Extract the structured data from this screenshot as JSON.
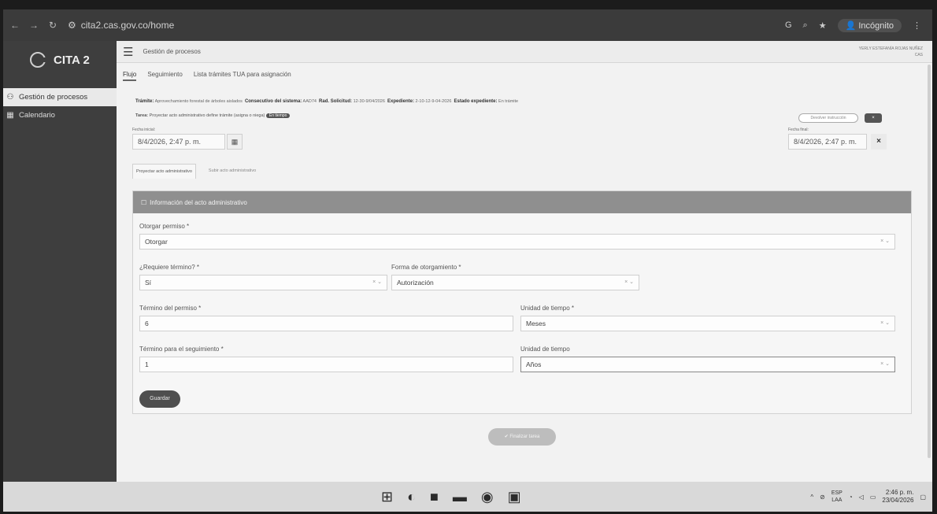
{
  "browser": {
    "url": "cita2.cas.gov.co/home",
    "incognito_label": "Incógnito",
    "icons": [
      "back-icon",
      "forward-icon",
      "reload-icon",
      "site-info-icon",
      "translate-icon",
      "zoom-icon",
      "star-icon",
      "incognito-icon",
      "kebab-menu-icon"
    ]
  },
  "sidebar": {
    "brand": "CITA 2",
    "items": [
      {
        "label": "Gestión de procesos",
        "icon": "hierarchy-icon"
      },
      {
        "label": "Calendario",
        "icon": "calendar-icon"
      }
    ]
  },
  "header": {
    "title": "Gestión de procesos",
    "user_line1": "YERLY ESTEFANÍA ROJAS NUÑEZ",
    "user_line2": "CAS"
  },
  "tabs": [
    {
      "label": "Flujo",
      "active": true
    },
    {
      "label": "Seguimiento",
      "active": false
    },
    {
      "label": "Lista trámites TUA para asignación",
      "active": false
    }
  ],
  "process_info": {
    "tramite_label": "Trámite:",
    "tramite_value": "Aprovechamiento forestal de árboles aislados",
    "consecutivo_label": "Consecutivo del sistema:",
    "consecutivo_value": "AAD74",
    "solicitud_label": "Rad. Solicitud:",
    "solicitud_value": "12-30-9/04/2026",
    "expediente_label": "Expediente:",
    "expediente_value": "2-10-12-9-04-2026",
    "estado_label": "Estado expediente:",
    "estado_value": "En trámite",
    "tarea_label": "Tarea:",
    "tarea_value": "Proyectar acto administrativo define trámite (asigna o niega)",
    "tarea_badge": "En tiempo",
    "return_button": "Devolver instrucción",
    "close_button": "×"
  },
  "dates": {
    "start_label": "Fecha inicial:",
    "start_value": "8/4/2026, 2:47 p. m.",
    "end_label": "Fecha final:",
    "end_value": "8/4/2026, 2:47 p. m."
  },
  "subtabs": [
    {
      "label": "Proyectar acto administrativo",
      "active": true
    },
    {
      "label": "Subir acto administrativo",
      "active": false
    }
  ],
  "panel": {
    "title": "Información del acto administrativo",
    "fields": {
      "otorgar_label": "Otorgar permiso *",
      "otorgar_value": "Otorgar",
      "requiere_label": "¿Requiere término? *",
      "requiere_value": "Sí",
      "forma_label": "Forma de otorgamiento *",
      "forma_value": "Autorización",
      "termino_label": "Término del permiso *",
      "termino_value": "6",
      "unidad_label": "Unidad de tiempo *",
      "unidad_value": "Meses",
      "seguimiento_label": "Término para el seguimiento *",
      "seguimiento_value": "1",
      "unidad2_label": "Unidad de tiempo",
      "unidad2_value": "Años"
    },
    "save_button": "Guardar"
  },
  "finish_button": "✔ Finalizar tarea",
  "taskbar": {
    "lang_top": "ESP",
    "lang_bottom": "LAA",
    "time": "2:46 p. m.",
    "date": "23/04/2026"
  }
}
